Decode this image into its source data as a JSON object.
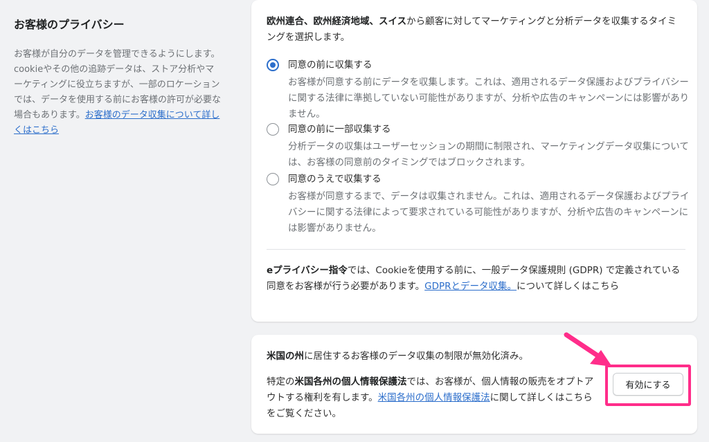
{
  "sidebar": {
    "title": "お客様のプライバシー",
    "description": "お客様が自分のデータを管理できるようにします。cookieやその他の追跡データは、ストア分析やマーケティングに役立ちますが、一部のロケーションでは、データを使用する前にお客様の許可が必要な場合もあります。",
    "link": "お客様のデータ収集について詳しくはこちら"
  },
  "eu_card": {
    "intro_bold": "欧州連合、欧州経済地域、スイス",
    "intro_rest": "から顧客に対してマーケティングと分析データを収集するタイミングを選択します。",
    "options": [
      {
        "label": "同意の前に収集する",
        "description": "お客様が同意する前にデータを収集します。これは、適用されるデータ保護およびプライバシーに関する法律に準拠していない可能性がありますが、分析や広告のキャンペーンには影響がありません。",
        "selected": true
      },
      {
        "label": "同意の前に一部収集する",
        "description": "分析データの収集はユーザーセッションの期間に制限され、マーケティングデータ収集については、お客様の同意前のタイミングではブロックされます。",
        "selected": false
      },
      {
        "label": "同意のうえで収集する",
        "description": "お客様が同意するまで、データは収集されません。これは、適用されるデータ保護およびプライバシーに関する法律によって要求されている可能性がありますが、分析や広告のキャンペーンには影響がありません。",
        "selected": false
      }
    ],
    "eprivacy_bold": "eプライバシー指令",
    "eprivacy_text": "では、Cookieを使用する前に、一般データ保護規則 (GDPR) で定義されている同意をお客様が行う必要があります。",
    "eprivacy_link": "GDPRとデータ収集。",
    "eprivacy_tail": "について詳しくはこちら"
  },
  "us_card": {
    "status_bold": "米国の州",
    "status_rest": "に居住するお客様のデータ収集の制限が無効化済み。",
    "law_prefix": "特定の",
    "law_bold": "米国各州の個人情報保護法",
    "law_text": "では、お客様が、個人情報の販売をオプトアウトする権利を有します。",
    "law_link": "米国各州の個人情報保護法",
    "law_tail": "に関して詳しくはこちらをご覧ください。",
    "enable_button": "有効にする"
  },
  "colors": {
    "accent": "#2c6ecb",
    "highlight": "#ff2d8a",
    "background": "#f1f2f4"
  }
}
